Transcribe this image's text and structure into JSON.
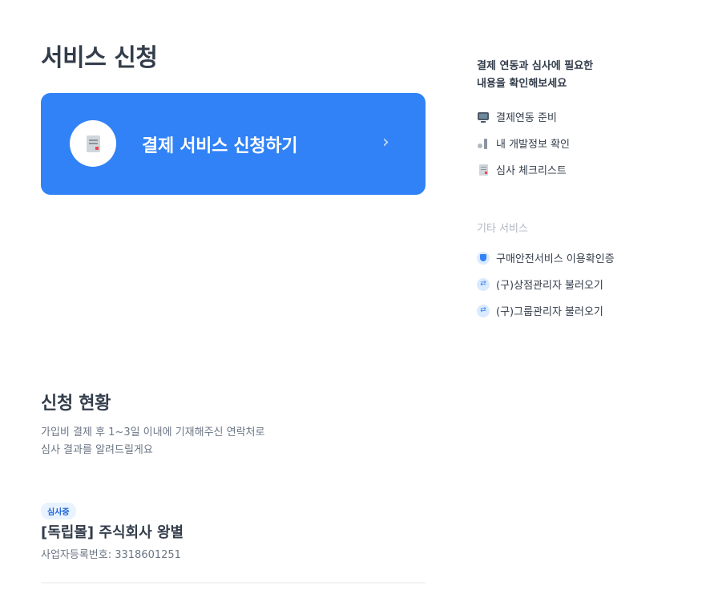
{
  "page": {
    "title": "서비스 신청"
  },
  "cta": {
    "label": "결제 서비스 신청하기",
    "icon": "document-icon",
    "chevron": "›",
    "accent_color": "#3182f6"
  },
  "status": {
    "title": "신청 현황",
    "description_lines": [
      "가입비 결제 후 1~3일 이내에 기재해주신 연락처로",
      "심사 결과를 알려드릴게요"
    ],
    "badge": "심사중",
    "store_name": "[독립몰] 주식회사 왕별",
    "business_number_label": "사업자등록번호: 3318601251"
  },
  "side": {
    "heading_lines": [
      "결제 연동과 심사에 필요한",
      "내용을 확인해보세요"
    ],
    "items": [
      {
        "label": "결제연동 준비",
        "icon": "monitor-icon"
      },
      {
        "label": "내 개발정보 확인",
        "icon": "tools-icon"
      },
      {
        "label": "심사 체크리스트",
        "icon": "document-icon"
      }
    ],
    "other_title": "기타 서비스",
    "other_items": [
      {
        "label": "구매안전서비스 이용확인증",
        "icon": "shield-icon"
      },
      {
        "label": "(구)상점관리자 불러오기",
        "icon": "refresh-icon"
      },
      {
        "label": "(구)그룹관리자 불러오기",
        "icon": "refresh-icon"
      }
    ]
  }
}
